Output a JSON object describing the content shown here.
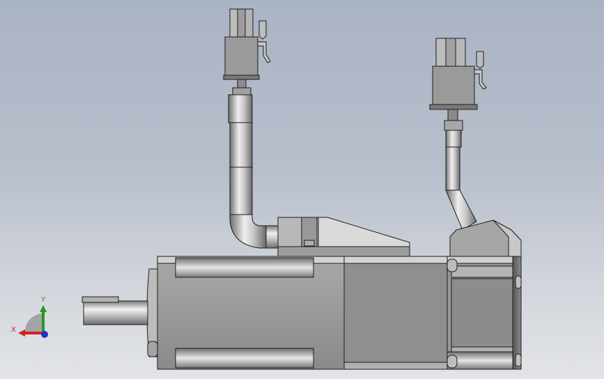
{
  "view": {
    "background_top": "#aab3c4",
    "background_bottom": "#e2e4e8"
  },
  "model": {
    "body_color": "#8f8f8f",
    "highlight_color": "#d4d4d4",
    "edge_color": "#1c1c1c"
  },
  "triad": {
    "x_label": "X",
    "y_label": "Y",
    "x_color": "#d42020",
    "y_color": "#1f9b1f",
    "z_color": "#2233cc"
  }
}
